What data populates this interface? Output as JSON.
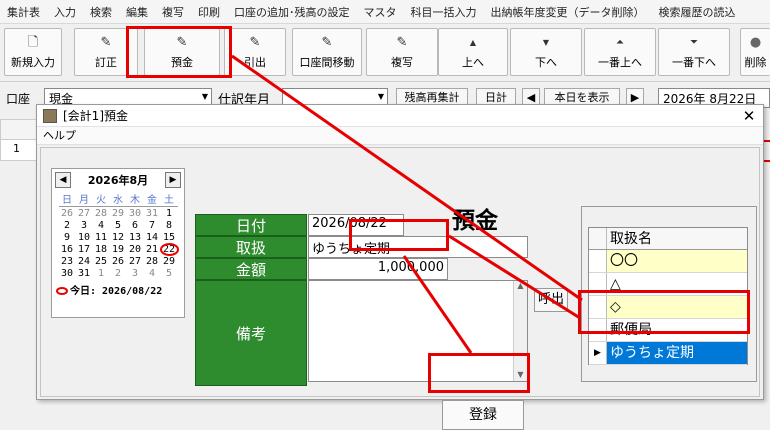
{
  "menubar": [
    "集計表",
    "入力",
    "検索",
    "編集",
    "複写",
    "印刷",
    "口座の追加･残高の設定",
    "マスタ",
    "科目一括入力",
    "出納帳年度変更（データ削除）",
    "検索履歴の読込"
  ],
  "toolbar": [
    {
      "label": "新規入力",
      "icon": "new-document-icon",
      "glyph": "🗋"
    },
    {
      "label": "訂正",
      "icon": "pencil-icon",
      "glyph": "✎"
    },
    {
      "label": "預金",
      "icon": "pencil-icon",
      "glyph": "✎"
    },
    {
      "label": "引出",
      "icon": "pencil-icon",
      "glyph": "✎"
    },
    {
      "label": "口座間移動",
      "icon": "pencil-icon",
      "glyph": "✎"
    },
    {
      "label": "複写",
      "icon": "pencil-icon",
      "glyph": "✎"
    },
    {
      "label": "上へ",
      "icon": "arrow-up-icon",
      "glyph": "▲"
    },
    {
      "label": "下へ",
      "icon": "arrow-down-icon",
      "glyph": "▼"
    },
    {
      "label": "一番上へ",
      "icon": "arrow-top-icon",
      "glyph": "⏶"
    },
    {
      "label": "一番下へ",
      "icon": "arrow-bottom-icon",
      "glyph": "⏷"
    },
    {
      "label": "削除",
      "icon": "delete-icon",
      "glyph": "●"
    }
  ],
  "row3": {
    "account_label": "口座",
    "account_value": "現金",
    "journal_label": "仕訳年月",
    "recalc_label": "残高再集計",
    "daily_label": "日計",
    "show_today_label": "本日を表示",
    "date_value": "2026年 8月22日",
    "row_number": "1"
  },
  "dialog": {
    "title": "[会計1]預金",
    "menu": "ヘルプ",
    "heading": "預金",
    "close": "✕"
  },
  "calendar": {
    "month": "2026年8月",
    "prev": "◀",
    "next": "▶",
    "weekdays": [
      "日",
      "月",
      "火",
      "水",
      "木",
      "金",
      "土"
    ],
    "weeks": [
      [
        "26",
        "27",
        "28",
        "29",
        "30",
        "31",
        "1"
      ],
      [
        "2",
        "3",
        "4",
        "5",
        "6",
        "7",
        "8"
      ],
      [
        "9",
        "10",
        "11",
        "12",
        "13",
        "14",
        "15"
      ],
      [
        "16",
        "17",
        "18",
        "19",
        "20",
        "21",
        "22"
      ],
      [
        "23",
        "24",
        "25",
        "26",
        "27",
        "28",
        "29"
      ],
      [
        "30",
        "31",
        "1",
        "2",
        "3",
        "4",
        "5"
      ]
    ],
    "today_label": "今日: 2026/08/22"
  },
  "form": {
    "date_label": "日付",
    "date_value": "2026/08/22",
    "handler_label": "取扱",
    "handler_value": "ゆうちょ定期",
    "amount_label": "金額",
    "amount_value": "1,000,000",
    "memo_label": "備考",
    "memo_value": "",
    "call_button": "呼出",
    "register_button": "登録"
  },
  "handlers": {
    "header": "取扱名",
    "items": [
      "〇〇",
      "△",
      "◇",
      "郵便局",
      "ゆうちょ定期"
    ]
  },
  "colors": {
    "label_green": "#2e8b2e",
    "highlight_yellow": "#ffffc8",
    "selection_blue": "#0078d7",
    "annotation_red": "#e60000"
  }
}
